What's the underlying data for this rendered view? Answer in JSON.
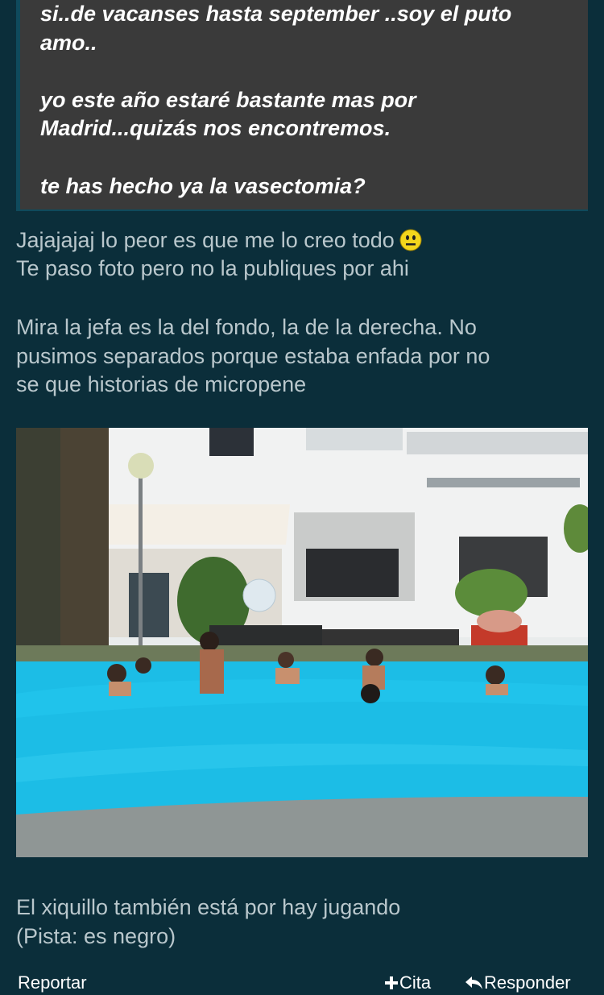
{
  "quote": {
    "lines": [
      "si..de vacanses hasta september ..soy el puto",
      "amo..",
      "yo este año estaré bastante mas por",
      "Madrid...quizás nos encontremos.",
      "te has hecho ya la vasectomia?"
    ]
  },
  "post": {
    "lines": [
      "Jajajajaj lo peor es que me lo creo todo",
      "Te paso foto pero no la publiques por ahi",
      "Mira la jefa es la del fondo, la de la derecha. No",
      "pusimos separados porque estaba enfada por no",
      "se que historias de micropene"
    ],
    "caption_lines": [
      "El xiquillo también está por hay jugando",
      "(Pista: es negro)"
    ]
  },
  "icons": {
    "smiley": "neutral-face-icon",
    "cita": "plus-icon",
    "responder": "reply-arrow-icon"
  },
  "footer": {
    "report_label": "Reportar",
    "cita_label": "Cita",
    "reply_label": "Responder"
  },
  "colors": {
    "background": "#0b2e3a",
    "quote_bg": "#3a3a3a",
    "text": "#b9c7cc",
    "pool": "#1cbde6"
  }
}
